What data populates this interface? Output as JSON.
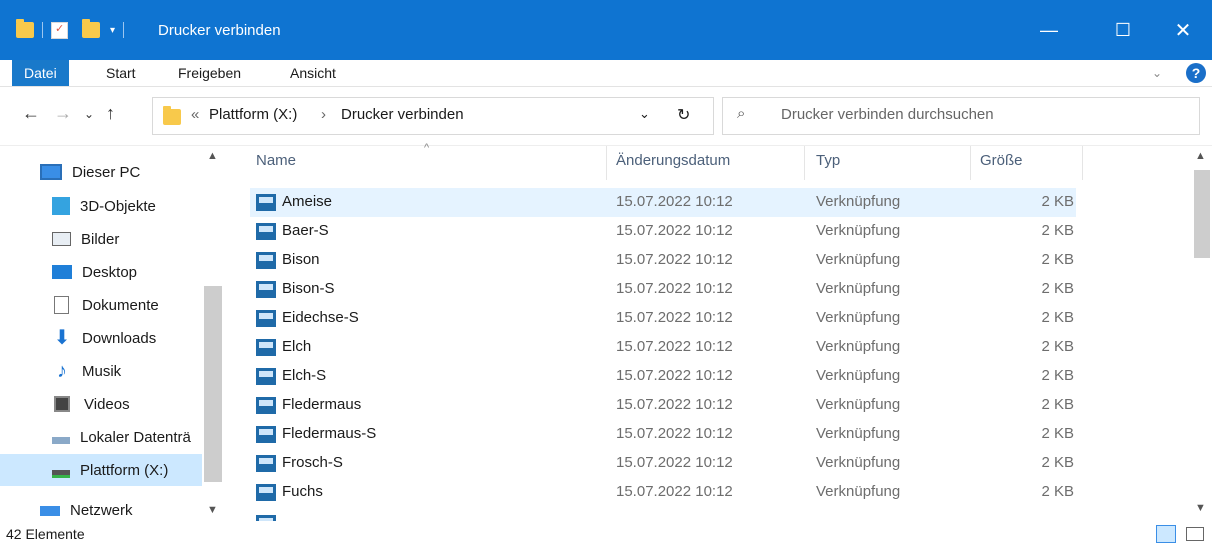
{
  "window": {
    "title": "Drucker verbinden"
  },
  "menu": {
    "items": [
      "Datei",
      "Start",
      "Freigeben",
      "Ansicht"
    ]
  },
  "address": {
    "overflow": "«",
    "crumbs": [
      "Plattform (X:)",
      "Drucker verbinden"
    ],
    "search_placeholder": "Drucker verbinden durchsuchen"
  },
  "nav": {
    "items": [
      {
        "label": "Dieser PC",
        "icon": "monitor-icon"
      },
      {
        "label": "3D-Objekte",
        "icon": "cube-icon"
      },
      {
        "label": "Bilder",
        "icon": "pictures-icon"
      },
      {
        "label": "Desktop",
        "icon": "desktop-icon"
      },
      {
        "label": "Dokumente",
        "icon": "document-icon"
      },
      {
        "label": "Downloads",
        "icon": "download-arrow-icon"
      },
      {
        "label": "Musik",
        "icon": "music-note-icon"
      },
      {
        "label": "Videos",
        "icon": "film-icon"
      },
      {
        "label": "Lokaler Datenträ",
        "icon": "drive-icon"
      },
      {
        "label": "Plattform (X:)",
        "icon": "network-drive-icon"
      },
      {
        "label": "Netzwerk",
        "icon": "network-icon"
      }
    ],
    "selected": "Plattform (X:)"
  },
  "columns": {
    "name": "Name",
    "date": "Änderungsdatum",
    "type": "Typ",
    "size": "Größe"
  },
  "files": [
    {
      "name": "Ameise",
      "date": "15.07.2022 10:12",
      "type": "Verknüpfung",
      "size": "2 KB"
    },
    {
      "name": "Baer-S",
      "date": "15.07.2022 10:12",
      "type": "Verknüpfung",
      "size": "2 KB"
    },
    {
      "name": "Bison",
      "date": "15.07.2022 10:12",
      "type": "Verknüpfung",
      "size": "2 KB"
    },
    {
      "name": "Bison-S",
      "date": "15.07.2022 10:12",
      "type": "Verknüpfung",
      "size": "2 KB"
    },
    {
      "name": "Eidechse-S",
      "date": "15.07.2022 10:12",
      "type": "Verknüpfung",
      "size": "2 KB"
    },
    {
      "name": "Elch",
      "date": "15.07.2022 10:12",
      "type": "Verknüpfung",
      "size": "2 KB"
    },
    {
      "name": "Elch-S",
      "date": "15.07.2022 10:12",
      "type": "Verknüpfung",
      "size": "2 KB"
    },
    {
      "name": "Fledermaus",
      "date": "15.07.2022 10:12",
      "type": "Verknüpfung",
      "size": "2 KB"
    },
    {
      "name": "Fledermaus-S",
      "date": "15.07.2022 10:12",
      "type": "Verknüpfung",
      "size": "2 KB"
    },
    {
      "name": "Frosch-S",
      "date": "15.07.2022 10:12",
      "type": "Verknüpfung",
      "size": "2 KB"
    },
    {
      "name": "Fuchs",
      "date": "15.07.2022 10:12",
      "type": "Verknüpfung",
      "size": "2 KB"
    }
  ],
  "status": {
    "count": "42 Elemente"
  },
  "colors": {
    "titlebar": "#0f74d1",
    "menu_file": "#1979ca",
    "selected_row": "#e5f3ff",
    "selected_nav": "#cce8ff"
  }
}
